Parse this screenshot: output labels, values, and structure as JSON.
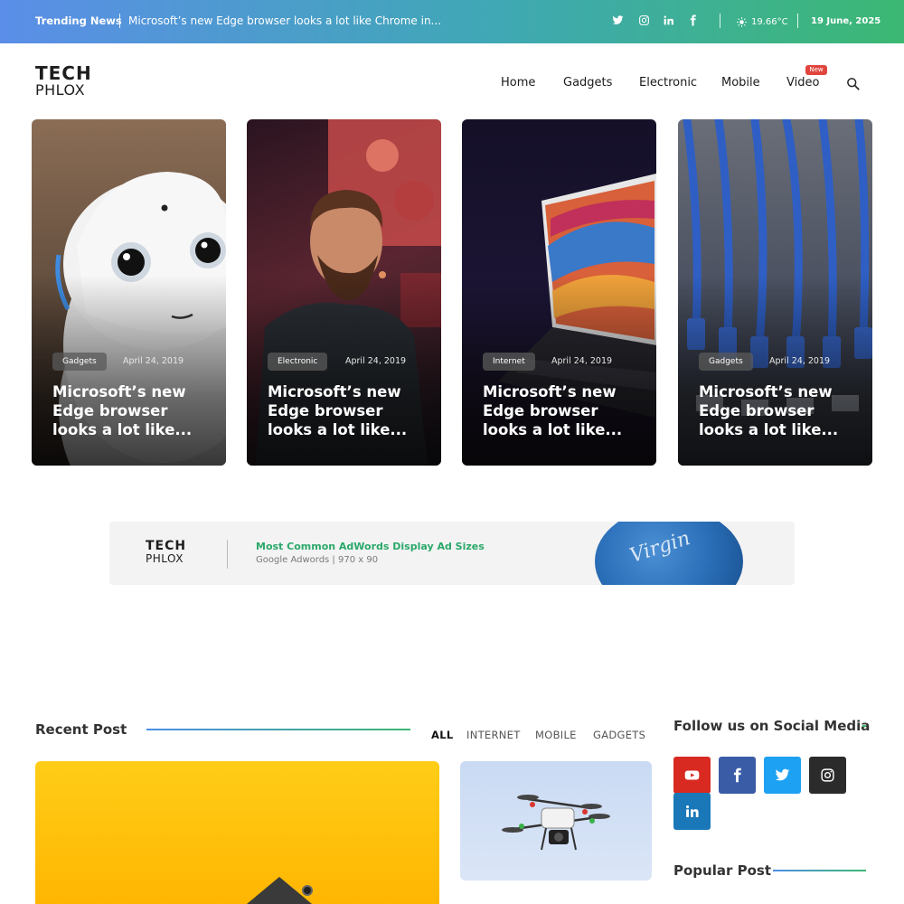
{
  "topbar": {
    "trending_label": "Trending News",
    "trending_text": "Microsoft’s new Edge browser looks a lot like Chrome in...",
    "weather": "19.66°C",
    "date": "19 June, 2025",
    "social_icons": [
      "twitter-icon",
      "instagram-icon",
      "linkedin-icon",
      "facebook-icon"
    ]
  },
  "header": {
    "logo_top": "TECH",
    "logo_bottom": "PHLOX",
    "nav": [
      "Home",
      "Gadgets",
      "Electronic",
      "Mobile",
      "Video"
    ],
    "video_badge": "New"
  },
  "hero_cards": [
    {
      "tag": "Gadgets",
      "date": "April 24, 2019",
      "title": "Microsoft’s new Edge browser looks a lot like..."
    },
    {
      "tag": "Electronic",
      "date": "April 24, 2019",
      "title": "Microsoft’s new Edge browser looks a lot like..."
    },
    {
      "tag": "Internet",
      "date": "April 24, 2019",
      "title": "Microsoft’s new Edge browser looks a lot like..."
    },
    {
      "tag": "Gadgets",
      "date": "April 24, 2019",
      "title": "Microsoft’s new Edge browser looks a lot like..."
    }
  ],
  "ad": {
    "logo_top": "TECH",
    "logo_bottom": "PHLOX",
    "title": "Most Common AdWords Display Ad Sizes",
    "subtitle": "Google Adwords  |  970 x 90",
    "brand": "Virgin"
  },
  "recent": {
    "title": "Recent Post",
    "filters": [
      "ALL",
      "INTERNET",
      "MOBILE",
      "GADGETS"
    ],
    "active_filter": "ALL"
  },
  "sidebar": {
    "follow_title": "Follow us on Social Media",
    "social": [
      {
        "icon": "youtube-icon",
        "color": "#d92a22"
      },
      {
        "icon": "facebook-icon",
        "color": "#3a5ca6"
      },
      {
        "icon": "twitter-icon",
        "color": "#1da1f2"
      },
      {
        "icon": "instagram-icon",
        "color": "#2b2b2b"
      },
      {
        "icon": "linkedin-icon",
        "color": "#1a78b8"
      }
    ],
    "popular_title": "Popular Post"
  },
  "colors": {
    "gradient_start": "#5b8ee8",
    "gradient_end": "#3cb873",
    "badge": "#e0463e"
  }
}
